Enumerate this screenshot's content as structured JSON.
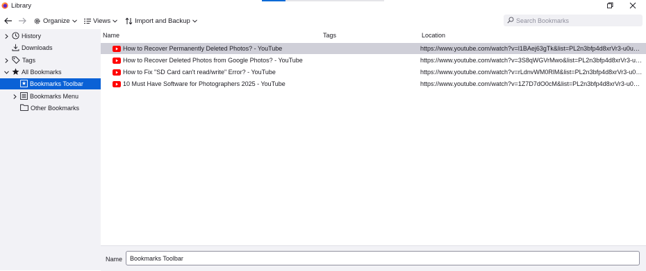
{
  "window": {
    "title": "Library",
    "app_icon": "firefox-icon",
    "controls": [
      "restore-icon",
      "close-icon"
    ]
  },
  "toolbar": {
    "back_icon": "arrow-left-icon",
    "forward_icon": "arrow-right-icon",
    "organize_label": "Organize",
    "views_label": "Views",
    "import_label": "Import and Backup",
    "search_placeholder": "Search Bookmarks"
  },
  "sidebar": {
    "items": [
      {
        "label": "History",
        "icon": "clock-icon",
        "expanded": false
      },
      {
        "label": "Downloads",
        "icon": "download-icon"
      },
      {
        "label": "Tags",
        "icon": "tag-icon",
        "expanded": false
      },
      {
        "label": "All Bookmarks",
        "icon": "star-icon",
        "expanded": true
      },
      {
        "label": "Bookmarks Toolbar",
        "icon": "bookmarks-toolbar-icon",
        "selected": true
      },
      {
        "label": "Bookmarks Menu",
        "icon": "bookmarks-menu-icon",
        "expanded": false
      },
      {
        "label": "Other Bookmarks",
        "icon": "folder-icon"
      }
    ]
  },
  "table": {
    "columns": [
      "Name",
      "Tags",
      "Location"
    ],
    "rows": [
      {
        "name": "How to Recover Permanently Deleted Photos? - YouTube",
        "tags": "",
        "location": "https://www.youtube.com/watch?v=l1BAej63gTk&list=PL2n3bfp4d8xrVr3-u0uFuJ...",
        "selected": true
      },
      {
        "name": "How to Recover Deleted Photos from Google Photos? - YouTube",
        "tags": "",
        "location": "https://www.youtube.com/watch?v=3S8qWGVrMwo&list=PL2n3bfp4d8xrVr3-u0u..."
      },
      {
        "name": "How to Fix \"SD Card can't read/write\" Error? - YouTube",
        "tags": "",
        "location": "https://www.youtube.com/watch?v=rLdnvWM0RlM&list=PL2n3bfp4d8xrVr3-u0uF..."
      },
      {
        "name": "10 Must Have Software for Photographers 2025 - YouTube",
        "tags": "",
        "location": "https://www.youtube.com/watch?v=1Z7D7dO0cM&list=PL2n3bfp4d8xrVr3-u0uF..."
      }
    ]
  },
  "details": {
    "name_label": "Name",
    "name_value": "Bookmarks Toolbar"
  },
  "colors": {
    "selection_accent": "#0a61d6",
    "selected_row": "#cfcfd8",
    "sidebar_bg": "#f2f2f6",
    "youtube_red": "#ff0000"
  }
}
